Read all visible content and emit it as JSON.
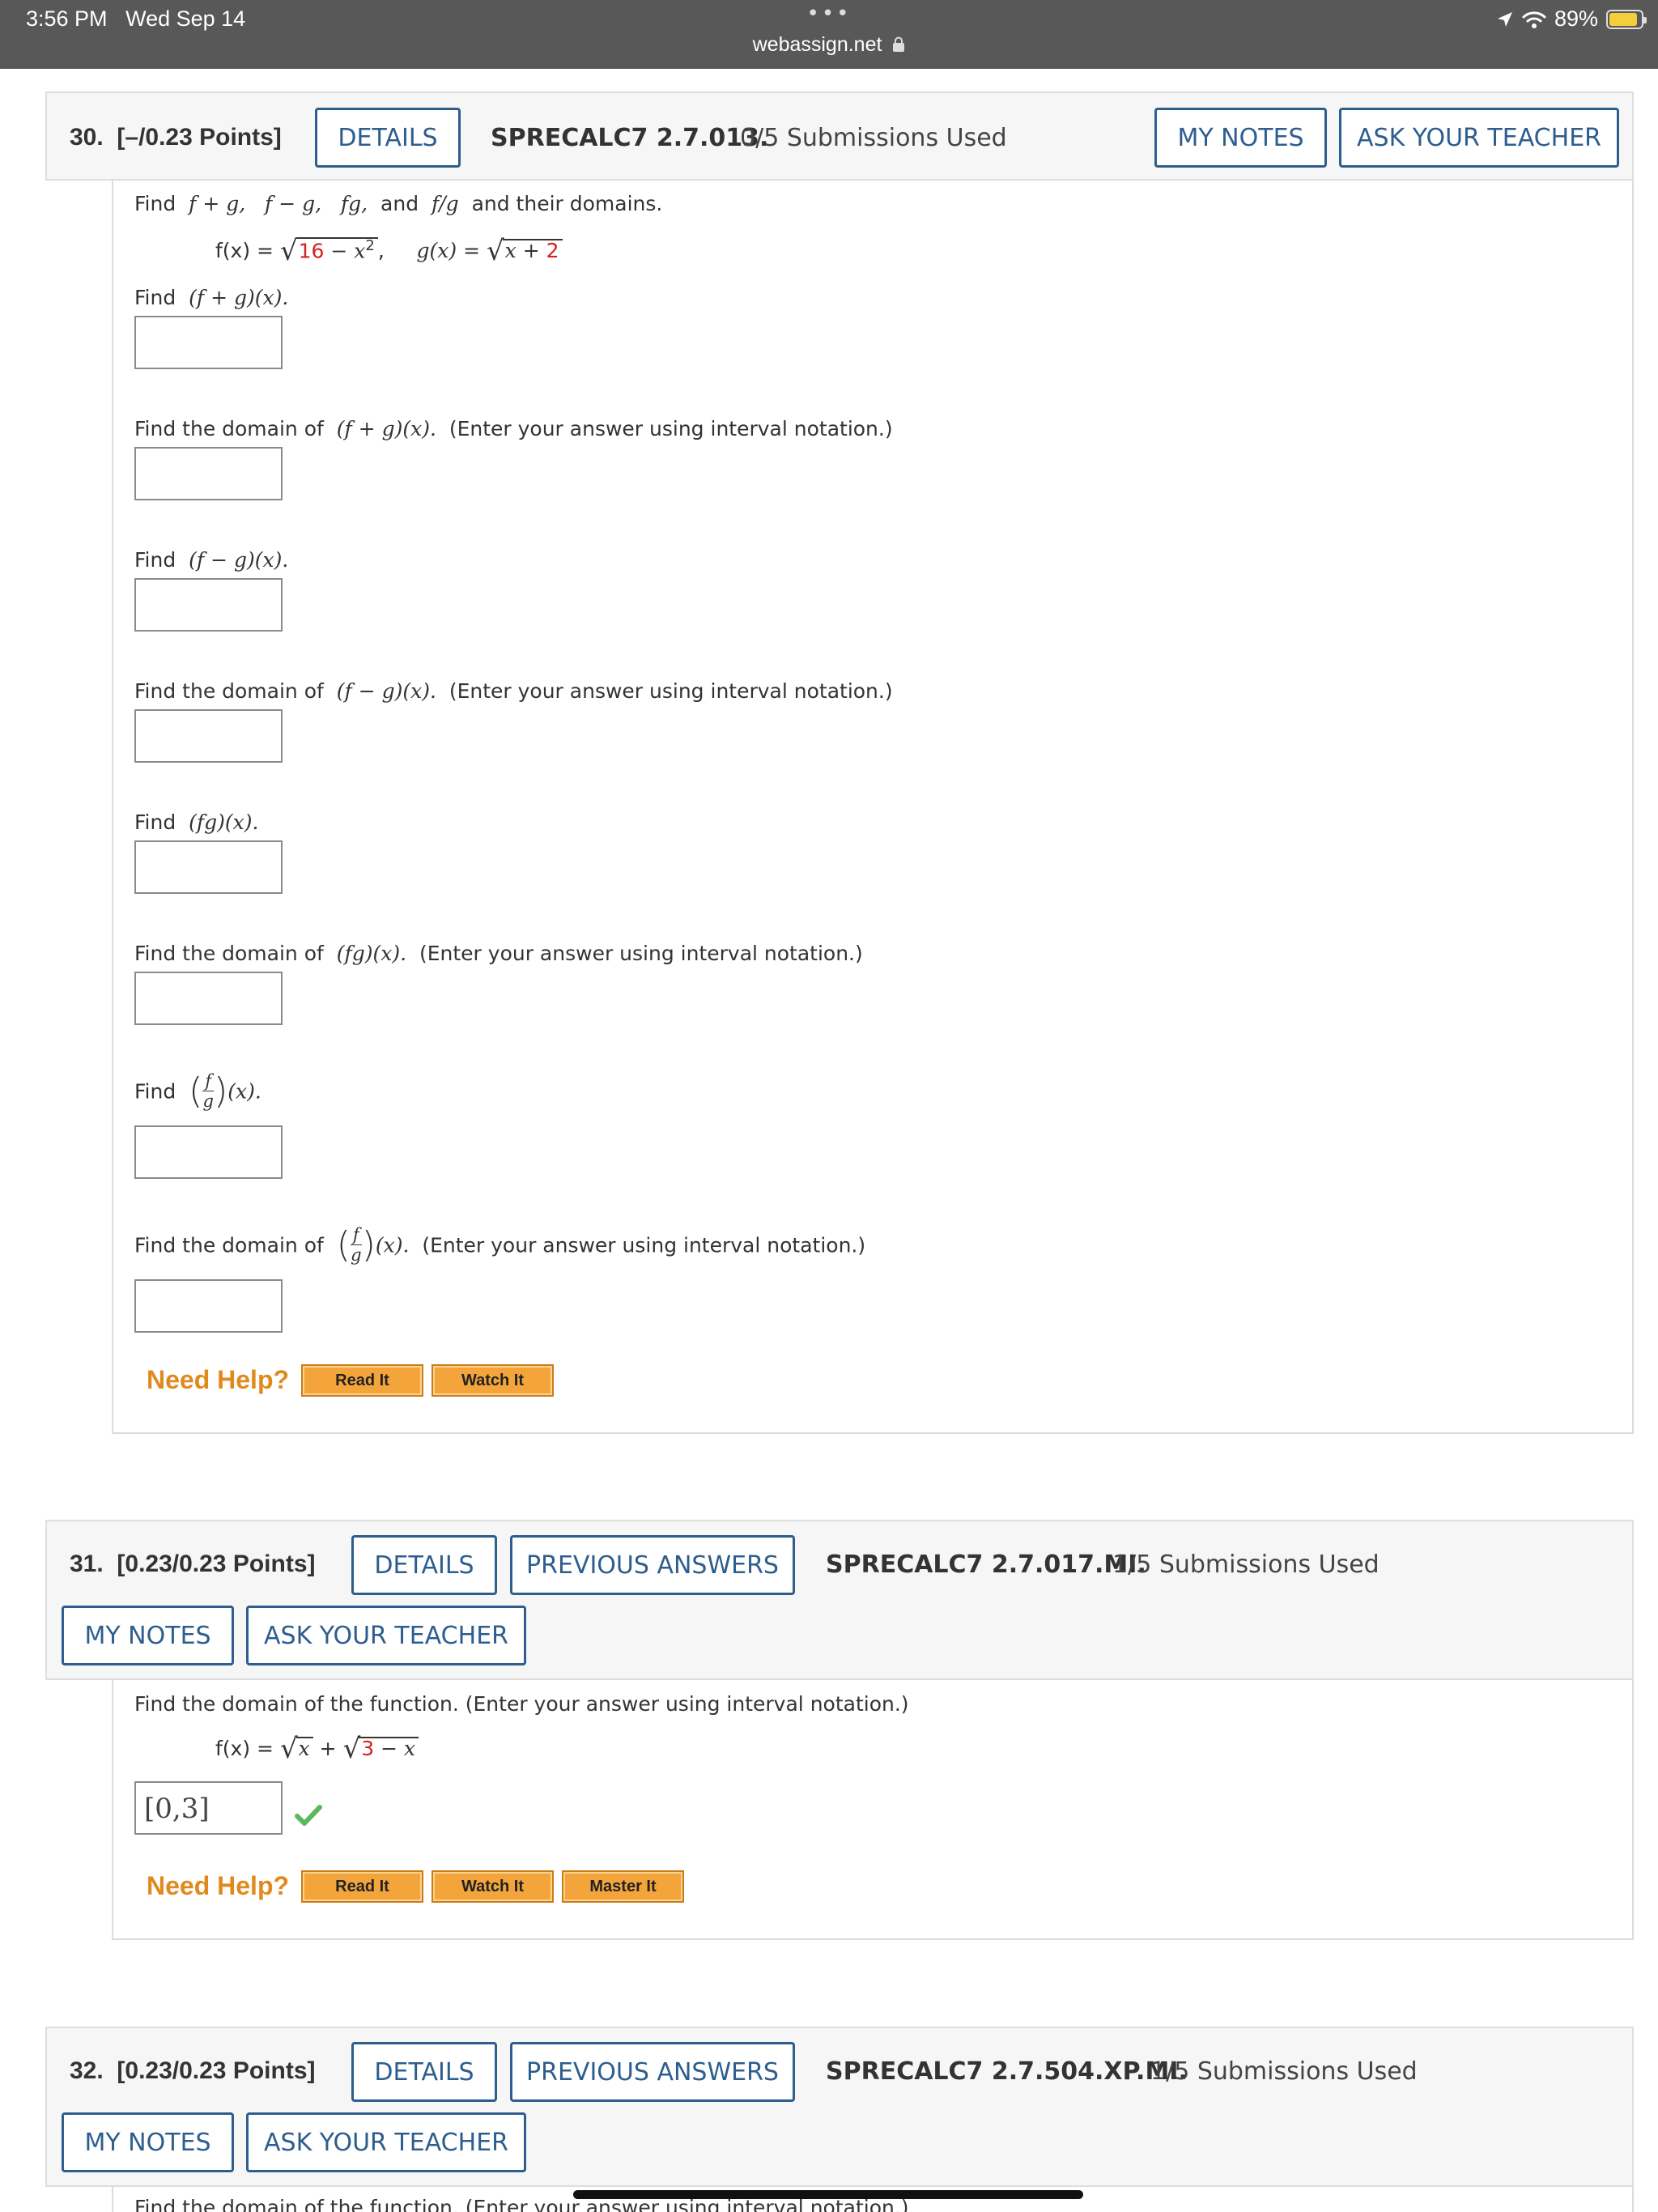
{
  "status_bar": {
    "time": "3:56 PM",
    "date": "Wed Sep 14",
    "more_dots": "•••",
    "url": "webassign.net",
    "battery_text": "89%",
    "battery_level": 0.89
  },
  "q30": {
    "number": "30.",
    "points": "[–/0.23 Points]",
    "details_label": "DETAILS",
    "code": "SPRECALC7 2.7.013.",
    "submissions": "0/5 Submissions Used",
    "my_notes_label": "MY NOTES",
    "ask_teacher_label": "ASK YOUR TEACHER",
    "prompt": {
      "find": "Find",
      "funcs": "f + g,   f − g,   fg,",
      "and": "and",
      "fg_div": "f/g",
      "tail": "and their domains."
    },
    "given": {
      "f_lhs": "f(x) = ",
      "f_rad_red": "16",
      "f_rad_rest": " − x",
      "f_exp": "2",
      "comma": ",",
      "g_lhs": "g(x) = ",
      "g_rad_a": "x + ",
      "g_rad_red": "2"
    },
    "parts": [
      {
        "find": "Find",
        "expr": "(f + g)(x).",
        "note": ""
      },
      {
        "find": "Find the domain of",
        "expr": "(f + g)(x).",
        "note": "(Enter your answer using interval notation.)"
      },
      {
        "find": "Find",
        "expr": "(f − g)(x).",
        "note": ""
      },
      {
        "find": "Find the domain of",
        "expr": "(f − g)(x).",
        "note": "(Enter your answer using interval notation.)"
      },
      {
        "find": "Find",
        "expr": "(fg)(x).",
        "note": ""
      },
      {
        "find": "Find the domain of",
        "expr": "(fg)(x).",
        "note": "(Enter your answer using interval notation.)"
      },
      {
        "find": "Find",
        "frac_num": "f",
        "frac_den": "g",
        "tail": "(x).",
        "note": ""
      },
      {
        "find": "Find the domain of",
        "frac_num": "f",
        "frac_den": "g",
        "tail": "(x).",
        "note": "(Enter your answer using interval notation.)"
      }
    ],
    "need_help": "Need Help?",
    "read_it": "Read It",
    "watch_it": "Watch It"
  },
  "q31": {
    "number": "31.",
    "points": "[0.23/0.23 Points]",
    "details_label": "DETAILS",
    "prev_answers_label": "PREVIOUS ANSWERS",
    "code": "SPRECALC7 2.7.017.MI.",
    "submissions": "1/5 Submissions Used",
    "my_notes_label": "MY NOTES",
    "ask_teacher_label": "ASK YOUR TEACHER",
    "prompt": "Find the domain of the function. (Enter your answer using interval notation.)",
    "given": {
      "lhs": "f(x) = ",
      "rad1": "x",
      "plus": " + ",
      "rad2_red": "3",
      "rad2_rest": " − x"
    },
    "answer_value": "[0,3]",
    "correct_mark": "✔",
    "need_help": "Need Help?",
    "read_it": "Read It",
    "watch_it": "Watch It",
    "master_it": "Master It"
  },
  "q32": {
    "number": "32.",
    "points": "[0.23/0.23 Points]",
    "details_label": "DETAILS",
    "prev_answers_label": "PREVIOUS ANSWERS",
    "code": "SPRECALC7 2.7.504.XP.MI.",
    "submissions": "1/5 Submissions Used",
    "my_notes_label": "MY NOTES",
    "ask_teacher_label": "ASK YOUR TEACHER",
    "prompt": "Find the domain of the function. (Enter your answer using interval notation.)"
  },
  "colors": {
    "status_bar_bg": "#585858",
    "button_blue": "#2d5e8e",
    "help_orange": "#e08a1e",
    "help_button": "#f3a53b",
    "math_red": "#d42121",
    "check_green": "#5cb85c"
  },
  "icons": [
    "location-arrow-icon",
    "wifi-icon",
    "battery-icon",
    "lock-icon",
    "checkmark-icon"
  ]
}
